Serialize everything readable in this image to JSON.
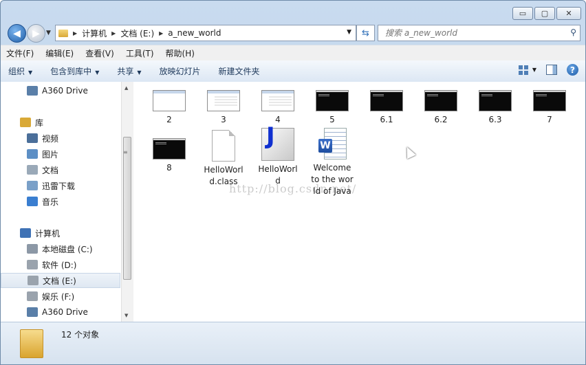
{
  "window": {
    "min_glyph": "▭",
    "max_glyph": "▢",
    "close_glyph": "✕"
  },
  "address": {
    "crumbs": [
      "计算机",
      "文档 (E:)",
      "a_new_world"
    ]
  },
  "search": {
    "placeholder": "搜索 a_new_world"
  },
  "menu": [
    "文件(F)",
    "编辑(E)",
    "查看(V)",
    "工具(T)",
    "帮助(H)"
  ],
  "commands": [
    {
      "label": "组织",
      "has_arrow": true
    },
    {
      "label": "包含到库中",
      "has_arrow": true
    },
    {
      "label": "共享",
      "has_arrow": true
    },
    {
      "label": "放映幻灯片",
      "has_arrow": false
    },
    {
      "label": "新建文件夹",
      "has_arrow": false
    }
  ],
  "nav": {
    "items": [
      {
        "label": "A360 Drive",
        "icon": "cloud-icon",
        "color": "#5a7fa8"
      },
      {
        "label": "库",
        "icon": "library-icon",
        "color": "#d9a937"
      },
      {
        "label": "视频",
        "icon": "video-icon",
        "color": "#4b6f9a"
      },
      {
        "label": "图片",
        "icon": "picture-icon",
        "color": "#5d8fc5"
      },
      {
        "label": "文档",
        "icon": "document-icon",
        "color": "#9aa9b8"
      },
      {
        "label": "迅雷下载",
        "icon": "download-folder-icon",
        "color": "#7aa0c8"
      },
      {
        "label": "音乐",
        "icon": "music-icon",
        "color": "#3a7ed0"
      },
      {
        "label": "计算机",
        "icon": "computer-icon",
        "color": "#3f72b5"
      },
      {
        "label": "本地磁盘 (C:)",
        "icon": "system-drive-icon",
        "color": "#8c98a6"
      },
      {
        "label": "软件 (D:)",
        "icon": "drive-icon",
        "color": "#9aa3ad"
      },
      {
        "label": "文档 (E:)",
        "icon": "drive-icon",
        "color": "#9aa3ad"
      },
      {
        "label": "娱乐 (F:)",
        "icon": "drive-icon",
        "color": "#9aa3ad"
      },
      {
        "label": "A360 Drive",
        "icon": "cloud-icon",
        "color": "#5a7fa8"
      }
    ],
    "selected_label": "文档 (E:)"
  },
  "files": [
    {
      "name": "2",
      "kind": "screenshot"
    },
    {
      "name": "3",
      "kind": "screenshot"
    },
    {
      "name": "4",
      "kind": "screenshot"
    },
    {
      "name": "5",
      "kind": "console"
    },
    {
      "name": "6.1",
      "kind": "console"
    },
    {
      "name": "6.2",
      "kind": "console"
    },
    {
      "name": "6.3",
      "kind": "console"
    },
    {
      "name": "7",
      "kind": "console"
    },
    {
      "name": "8",
      "kind": "console"
    },
    {
      "name": "HelloWorld.class",
      "kind": "blank-document"
    },
    {
      "name": "HelloWorld",
      "kind": "java-source",
      "glyph": "J"
    },
    {
      "name": "Welcome to the world of Java",
      "kind": "word-document",
      "glyph": "W"
    }
  ],
  "watermark": "http://blog.csdn.net/",
  "status": {
    "count_text": "12 个对象"
  }
}
